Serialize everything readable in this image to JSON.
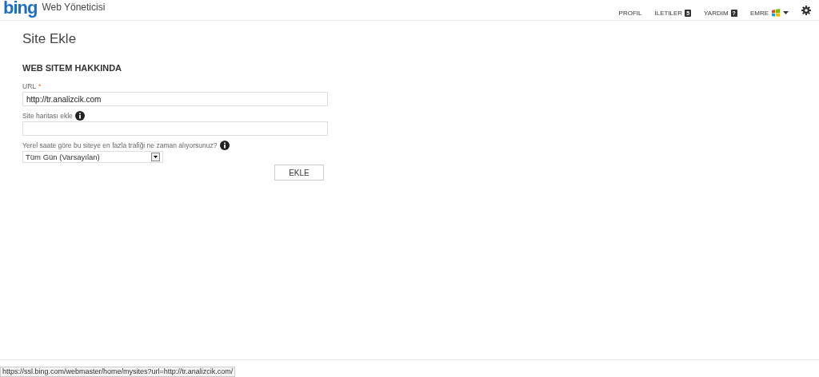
{
  "header": {
    "logo": "bing",
    "app_title": "Web Yöneticisi",
    "nav": [
      {
        "label": "PROFIL"
      },
      {
        "label": "İLETILER",
        "badge": "5"
      },
      {
        "label": "YARDIM",
        "badge": "?"
      },
      {
        "label": "EMRE",
        "kind": "user"
      }
    ]
  },
  "page": {
    "title": "Site Ekle",
    "section": "WEB SITEM HAKKINDA",
    "fields": [
      {
        "kind": "text",
        "label": "URL",
        "required_mark": "*",
        "value": "http://tr.analizcik.com"
      },
      {
        "kind": "text",
        "label": "Site haritası ekle",
        "info": true
      },
      {
        "kind": "select",
        "label": "Yerel saate göre bu siteye en fazla trafiği ne zaman alıyorsunuz?",
        "info": true,
        "value": "Tüm Gün (Varsayılan)"
      }
    ],
    "submit": "EKLE"
  },
  "status_bar": {
    "url": "https://ssl.bing.com/webmaster/home/mysites?url=http://tr.analizcik.com/"
  }
}
